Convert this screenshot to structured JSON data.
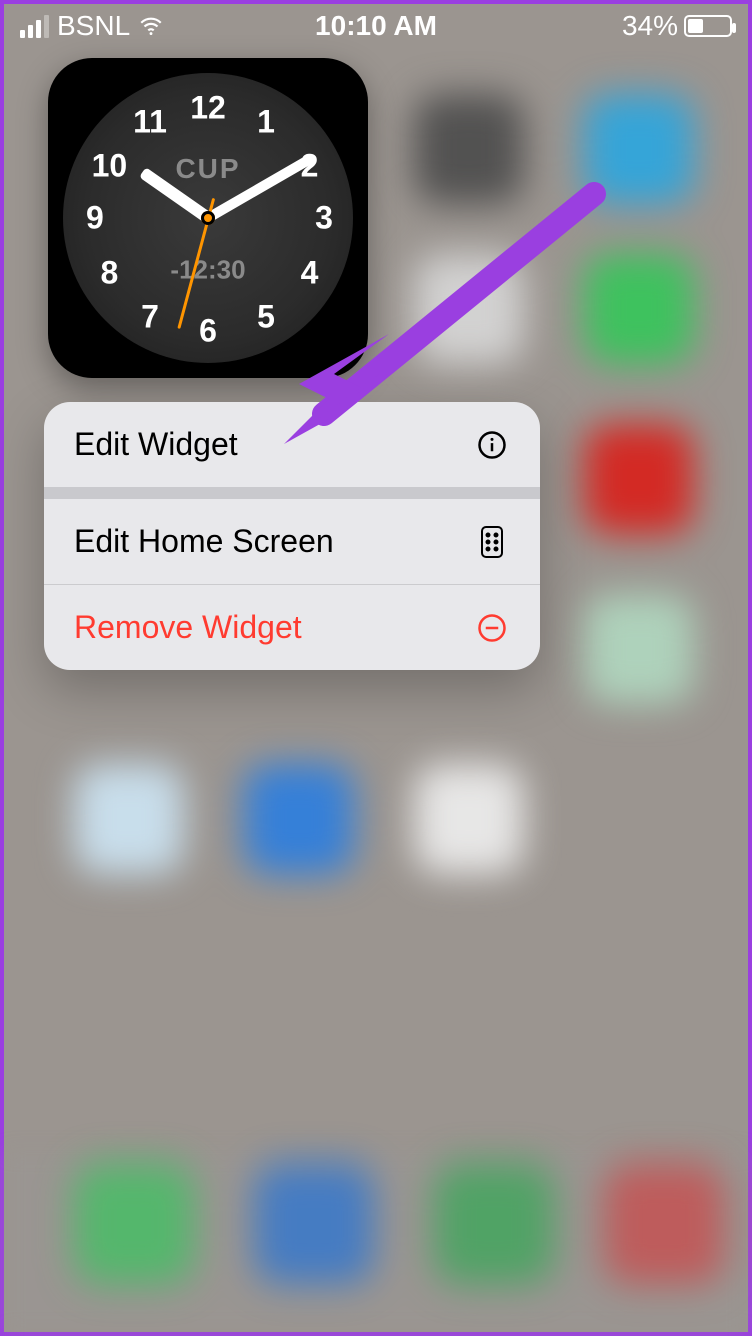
{
  "status": {
    "carrier": "BSNL",
    "time": "10:10 AM",
    "battery_percent": "34%"
  },
  "clock": {
    "city": "CUP",
    "offset": "-12:30",
    "numbers": [
      "12",
      "1",
      "2",
      "3",
      "4",
      "5",
      "6",
      "7",
      "8",
      "9",
      "10",
      "11"
    ],
    "hour_angle": 305,
    "minute_angle": 60,
    "second_angle": 195
  },
  "menu": {
    "edit_widget": "Edit Widget",
    "edit_home": "Edit Home Screen",
    "remove_widget": "Remove Widget"
  },
  "colors": {
    "accent_purple": "#9a3fe0",
    "danger": "#ff3b30",
    "second_hand": "#ff9500"
  }
}
